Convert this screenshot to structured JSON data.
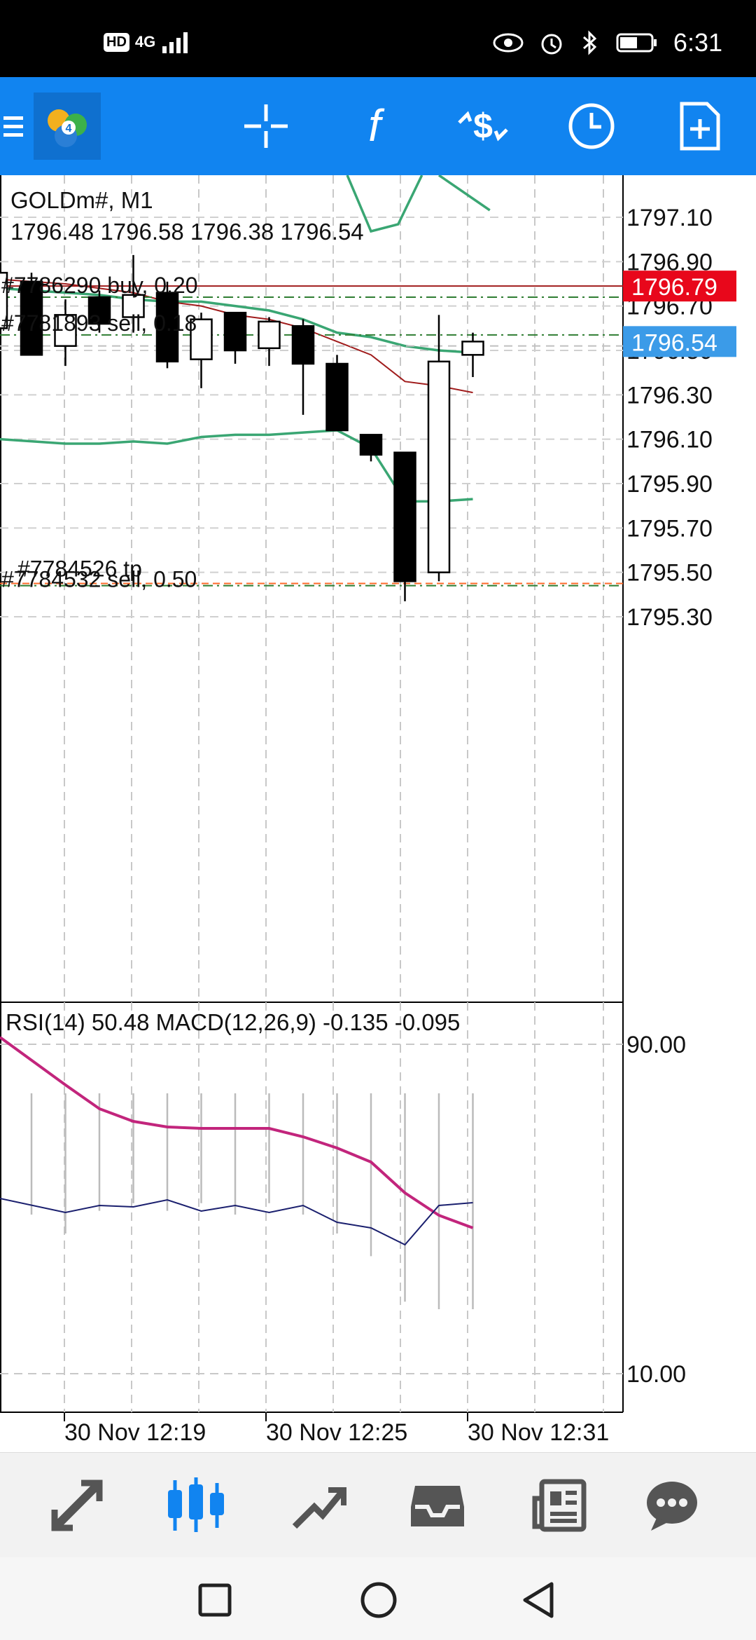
{
  "status_bar": {
    "network_hd": "HD",
    "network_type": "4G",
    "time": "6:31"
  },
  "toolbar": {
    "icons": [
      "menu-icon",
      "metatrader-logo-icon",
      "crosshair-icon",
      "indicator-function-icon",
      "trade-dollar-icon",
      "clock-timeframe-icon",
      "new-order-icon"
    ]
  },
  "chart": {
    "symbol_timeframe": "GOLDm#, M1",
    "ohlc": "1796.48 1796.58 1796.38 1796.54",
    "price_axis": [
      "1797.10",
      "1796.90",
      "1796.70",
      "1796.50",
      "1796.30",
      "1796.10",
      "1795.90",
      "1795.70",
      "1795.50",
      "1795.30"
    ],
    "price_tag_red": "1796.79",
    "price_tag_blue": "1796.54",
    "order_labels": [
      "#7786290 buy, 0.20",
      "#7781893 sell, 0.18",
      "#7784526 tp",
      "#7784532 sell, 0.50"
    ],
    "colors": {
      "bull_body": "#ffffff",
      "bear_body": "#000000",
      "ma_green": "#3aa673",
      "ma_red": "#a01c1c",
      "price_tag_red": "#e8071b",
      "price_tag_blue": "#3b9be8",
      "tp_line": "#ff6a2a"
    }
  },
  "indicator": {
    "header": "RSI(14) 50.48 MACD(12,26,9) -0.135 -0.095",
    "axis": [
      "90.00",
      "10.00"
    ],
    "colors": {
      "signal": "#c2257c",
      "rsi": "#1a1f6e"
    }
  },
  "time_axis": [
    "30 Nov 12:19",
    "30 Nov 12:25",
    "30 Nov 12:31"
  ],
  "chart_data": {
    "type": "candlestick",
    "candles": [
      {
        "o": 1796.81,
        "h": 1796.85,
        "l": 1796.48,
        "c": 1796.48
      },
      {
        "o": 1796.52,
        "h": 1796.73,
        "l": 1796.43,
        "c": 1796.66
      },
      {
        "o": 1796.74,
        "h": 1796.77,
        "l": 1796.58,
        "c": 1796.62
      },
      {
        "o": 1796.65,
        "h": 1796.93,
        "l": 1796.58,
        "c": 1796.75
      },
      {
        "o": 1796.76,
        "h": 1796.81,
        "l": 1796.42,
        "c": 1796.45
      },
      {
        "o": 1796.46,
        "h": 1796.67,
        "l": 1796.33,
        "c": 1796.64
      },
      {
        "o": 1796.67,
        "h": 1796.67,
        "l": 1796.44,
        "c": 1796.5
      },
      {
        "o": 1796.51,
        "h": 1796.65,
        "l": 1796.43,
        "c": 1796.63
      },
      {
        "o": 1796.61,
        "h": 1796.64,
        "l": 1796.21,
        "c": 1796.44
      },
      {
        "o": 1796.44,
        "h": 1796.48,
        "l": 1796.14,
        "c": 1796.14
      },
      {
        "o": 1796.12,
        "h": 1796.12,
        "l": 1796.0,
        "c": 1796.03
      },
      {
        "o": 1796.04,
        "h": 1796.04,
        "l": 1795.37,
        "c": 1795.46
      },
      {
        "o": 1795.5,
        "h": 1796.66,
        "l": 1795.46,
        "c": 1796.45
      },
      {
        "o": 1796.48,
        "h": 1796.58,
        "l": 1796.38,
        "c": 1796.54
      }
    ],
    "levels": {
      "buy_order": 1796.79,
      "sell_order": 1796.57,
      "tp": 1795.45,
      "sell_order_2": 1795.44
    },
    "ylim": [
      1795.16,
      1797.18
    ]
  }
}
